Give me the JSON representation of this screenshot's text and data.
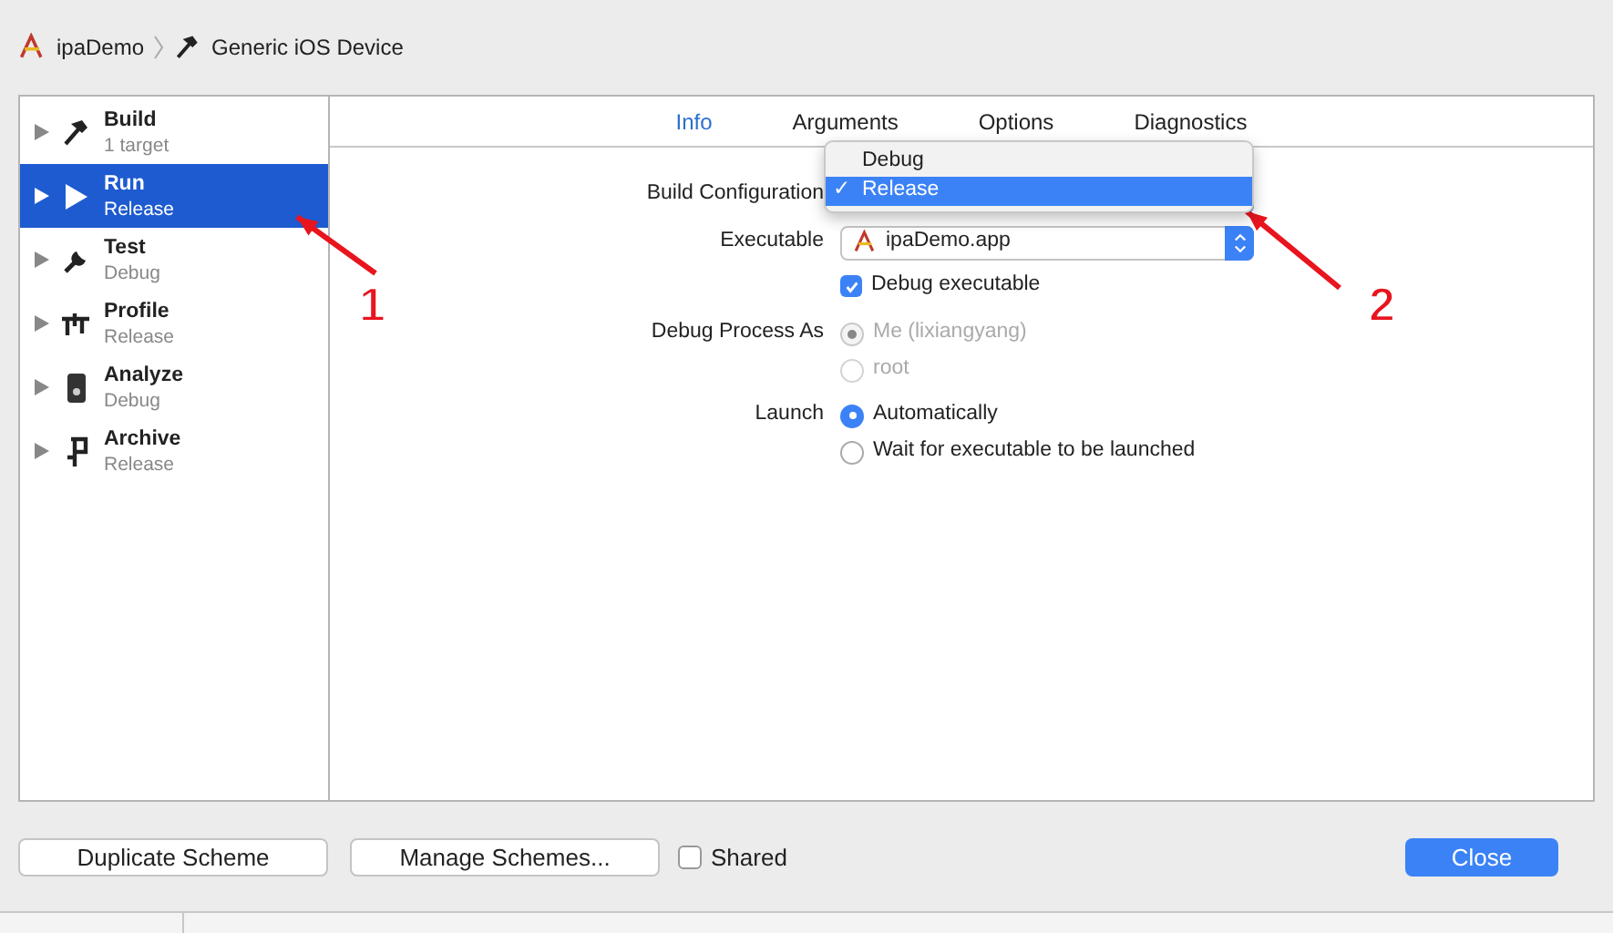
{
  "breadcrumb": [
    {
      "text": "ipaDemo"
    },
    {
      "text": "Generic iOS Device"
    }
  ],
  "schemes": [
    {
      "name": "Build",
      "subtitle": "1 target",
      "selected": false
    },
    {
      "name": "Run",
      "subtitle": "Release",
      "selected": true
    },
    {
      "name": "Test",
      "subtitle": "Debug",
      "selected": false
    },
    {
      "name": "Profile",
      "subtitle": "Release",
      "selected": false
    },
    {
      "name": "Analyze",
      "subtitle": "Debug",
      "selected": false
    },
    {
      "name": "Archive",
      "subtitle": "Release",
      "selected": false
    }
  ],
  "tabs": [
    {
      "label": "Info",
      "selected": true
    },
    {
      "label": "Arguments",
      "selected": false
    },
    {
      "label": "Options",
      "selected": false
    },
    {
      "label": "Diagnostics",
      "selected": false
    }
  ],
  "form": {
    "build_configuration": {
      "label": "Build Configuration",
      "options": [
        {
          "label": "Debug",
          "selected": false
        },
        {
          "label": "Release",
          "selected": true
        }
      ],
      "check_mark": "✓"
    },
    "executable": {
      "label": "Executable",
      "value": "ipaDemo.app"
    },
    "debug_executable": {
      "label": "Debug executable",
      "checked": true
    },
    "debug_process_as": {
      "label": "Debug Process As",
      "options": [
        {
          "label": "Me (lixiangyang)",
          "selected": true,
          "disabled": true
        },
        {
          "label": "root",
          "selected": false,
          "disabled": true
        }
      ]
    },
    "launch": {
      "label": "Launch",
      "options": [
        {
          "label": "Automatically",
          "selected": true,
          "disabled": false
        },
        {
          "label": "Wait for executable to be launched",
          "selected": false,
          "disabled": false
        }
      ]
    }
  },
  "buttons": {
    "duplicate": "Duplicate Scheme",
    "manage": "Manage Schemes...",
    "shared": {
      "label": "Shared",
      "checked": false
    },
    "close": "Close"
  },
  "annotations": [
    {
      "label": "1"
    },
    {
      "label": "2"
    }
  ]
}
